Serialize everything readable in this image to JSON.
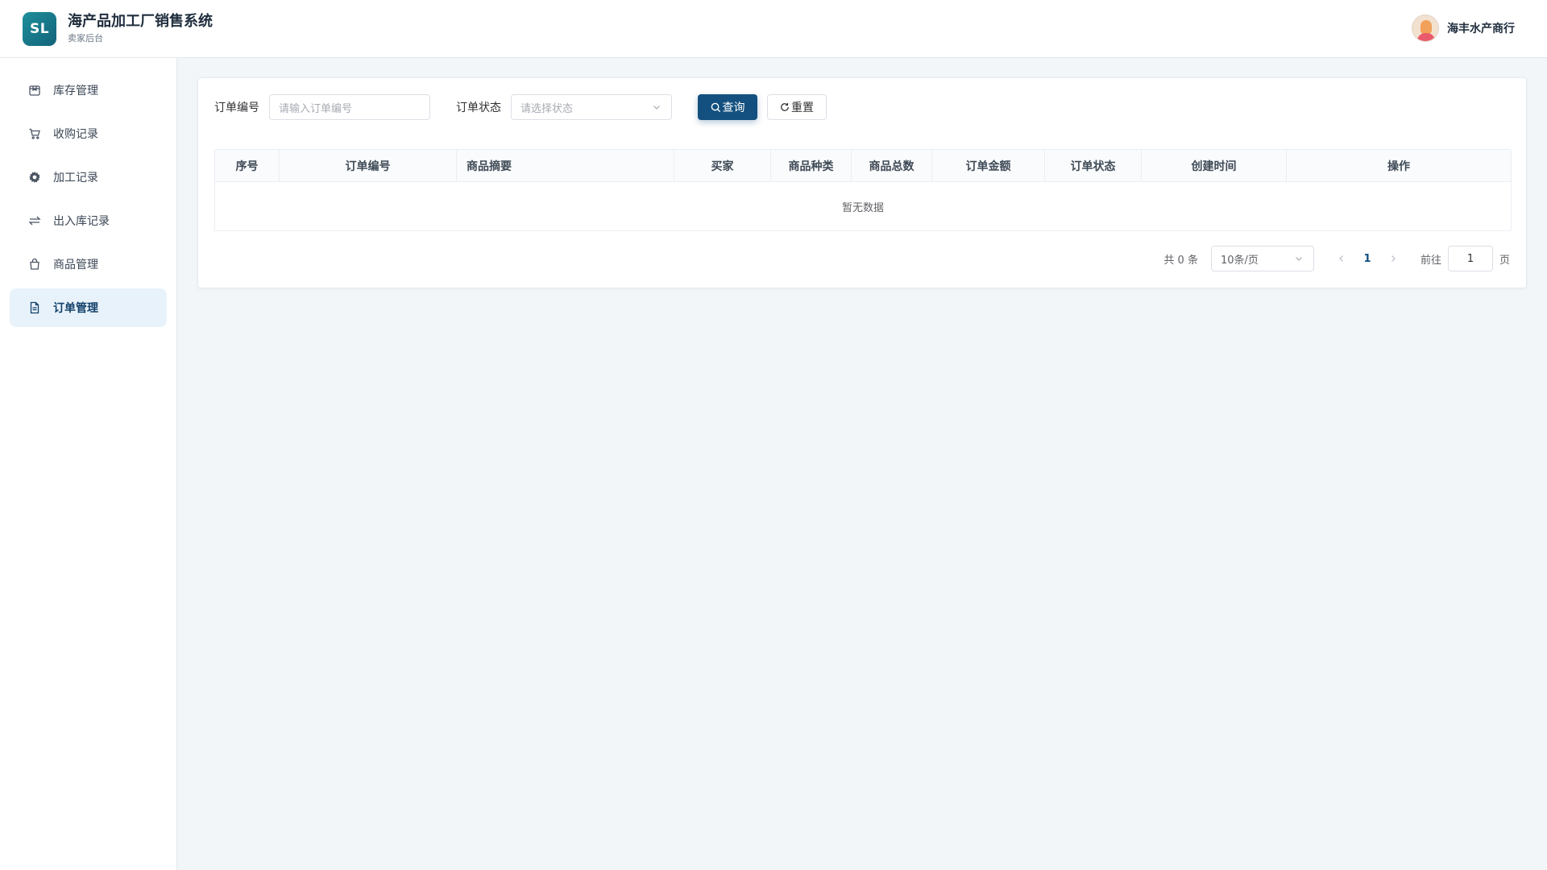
{
  "header": {
    "logo_text": "SL",
    "title": "海产品加工厂销售系统",
    "subtitle": "卖家后台",
    "user_name": "海丰水产商行"
  },
  "sidebar": {
    "items": [
      {
        "label": "库存管理",
        "icon": "package-icon",
        "active": false
      },
      {
        "label": "收购记录",
        "icon": "cart-icon",
        "active": false
      },
      {
        "label": "加工记录",
        "icon": "gear-icon",
        "active": false
      },
      {
        "label": "出入库记录",
        "icon": "transfer-arrows-icon",
        "active": false
      },
      {
        "label": "商品管理",
        "icon": "shopping-bag-icon",
        "active": false
      },
      {
        "label": "订单管理",
        "icon": "document-icon",
        "active": true
      }
    ]
  },
  "filters": {
    "order_no_label": "订单编号",
    "order_no_placeholder": "请输入订单编号",
    "status_label": "订单状态",
    "status_placeholder": "请选择状态",
    "search_label": "查询",
    "reset_label": "重置"
  },
  "table": {
    "columns": [
      "序号",
      "订单编号",
      "商品摘要",
      "买家",
      "商品种类",
      "商品总数",
      "订单金额",
      "订单状态",
      "创建时间",
      "操作"
    ],
    "rows": [],
    "empty_text": "暂无数据"
  },
  "pagination": {
    "total_text": "共 0 条",
    "page_size": "10条/页",
    "current_page": "1",
    "goto_label": "前往",
    "goto_value": "1",
    "page_unit": "页"
  },
  "colors": {
    "primary": "#13507f",
    "logo_gradient_start": "#1f8f9a",
    "logo_gradient_end": "#12627a",
    "active_nav_bg": "#e8f2fa",
    "page_bg": "#f2f6f9"
  }
}
